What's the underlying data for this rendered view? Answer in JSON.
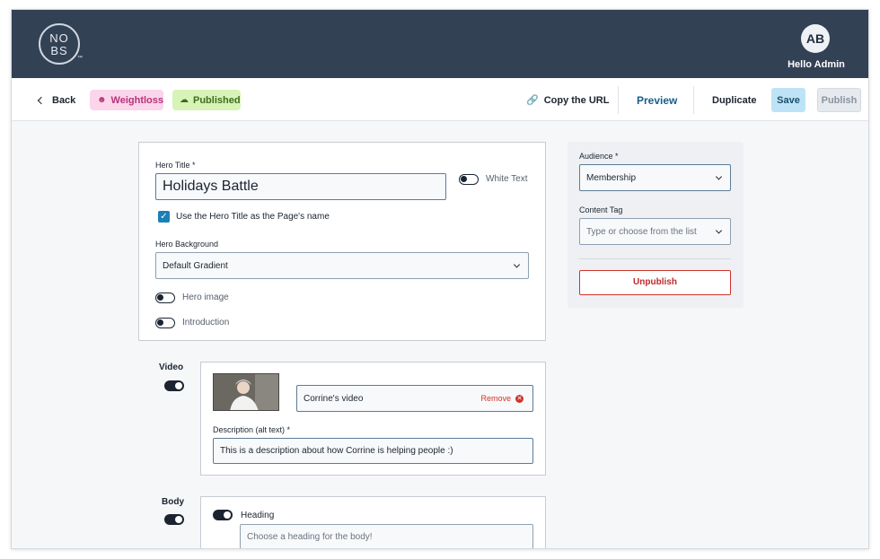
{
  "header": {
    "logo_top": "NO",
    "logo_bottom": "BS",
    "logo_tm": "™",
    "avatar_initials": "AB",
    "greeting": "Hello Admin"
  },
  "toolbar": {
    "back_label": "Back",
    "category_label": "Weightloss",
    "status_label": "Published",
    "copy_url_label": "Copy the URL",
    "preview_label": "Preview",
    "duplicate_label": "Duplicate",
    "save_label": "Save",
    "publish_label": "Publish"
  },
  "hero": {
    "title_label": "Hero Title *",
    "title_value": "Holidays Battle",
    "white_text_label": "White Text",
    "use_title_label": "Use the Hero Title as the Page's name",
    "background_label": "Hero Background",
    "background_value": "Default Gradient",
    "hero_image_label": "Hero image",
    "introduction_label": "Introduction"
  },
  "video": {
    "section_label": "Video",
    "video_name": "Corrine's video",
    "remove_label": "Remove",
    "description_label": "Description (alt text) *",
    "description_value": "This is a description about how Corrine is helping people :)"
  },
  "body": {
    "section_label": "Body",
    "heading_label": "Heading",
    "heading_placeholder": "Choose a heading for the body!"
  },
  "sidebar": {
    "audience_label": "Audience *",
    "audience_value": "Membership",
    "content_tag_label": "Content Tag",
    "content_tag_placeholder": "Type or choose from the list",
    "unpublish_label": "Unpublish"
  },
  "colors": {
    "header_bg": "#334155",
    "accent_blue": "#1b80b5",
    "danger": "#d0342c",
    "weightloss_pill": "#fbd6ea",
    "published_pill": "#d7f3b8"
  }
}
